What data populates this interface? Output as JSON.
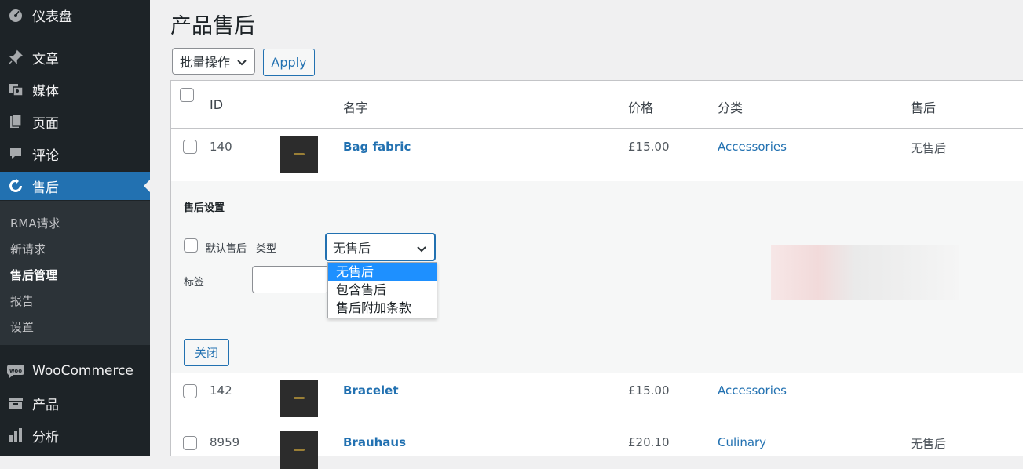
{
  "sidebar": {
    "items": [
      {
        "label": "仪表盘",
        "icon": "dashboard-icon"
      },
      {
        "label": "文章",
        "icon": "pin-icon"
      },
      {
        "label": "媒体",
        "icon": "media-icon"
      },
      {
        "label": "页面",
        "icon": "page-icon"
      },
      {
        "label": "评论",
        "icon": "comment-icon"
      },
      {
        "label": "售后",
        "icon": "refresh-icon"
      },
      {
        "label": "WooCommerce",
        "icon": "woo-icon"
      },
      {
        "label": "产品",
        "icon": "archive-icon"
      },
      {
        "label": "分析",
        "icon": "bar-chart-icon"
      }
    ],
    "submenu": [
      "RMA请求",
      "新请求",
      "售后管理",
      "报告",
      "设置"
    ],
    "current_submenu": "售后管理"
  },
  "header": {
    "title": "产品售后"
  },
  "toolbar": {
    "bulk_label": "批量操作",
    "apply_label": "Apply"
  },
  "table": {
    "columns": {
      "id": "ID",
      "name": "名字",
      "price": "价格",
      "category": "分类",
      "aftersales": "售后"
    },
    "rows": [
      {
        "id": "140",
        "name": "Bag fabric",
        "price": "£15.00",
        "category": "Accessories",
        "aftersales": "无售后"
      },
      {
        "id": "142",
        "name": "Bracelet",
        "price": "£15.00",
        "category": "Accessories",
        "aftersales": ""
      },
      {
        "id": "8959",
        "name": "Brauhaus",
        "price": "£20.10",
        "category": "Culinary",
        "aftersales": "无售后"
      }
    ]
  },
  "edit_panel": {
    "title": "售后设置",
    "default_label": "默认售后",
    "type_label": "类型",
    "type_value": "无售后",
    "tag_label": "标签",
    "tag_value": "",
    "options": [
      "无售后",
      "包含售后",
      "售后附加条款"
    ],
    "close_label": "关闭"
  },
  "colors": {
    "accent": "#2271b1",
    "sidebar": "#1d2327",
    "selected_option": "#1e90ff"
  }
}
